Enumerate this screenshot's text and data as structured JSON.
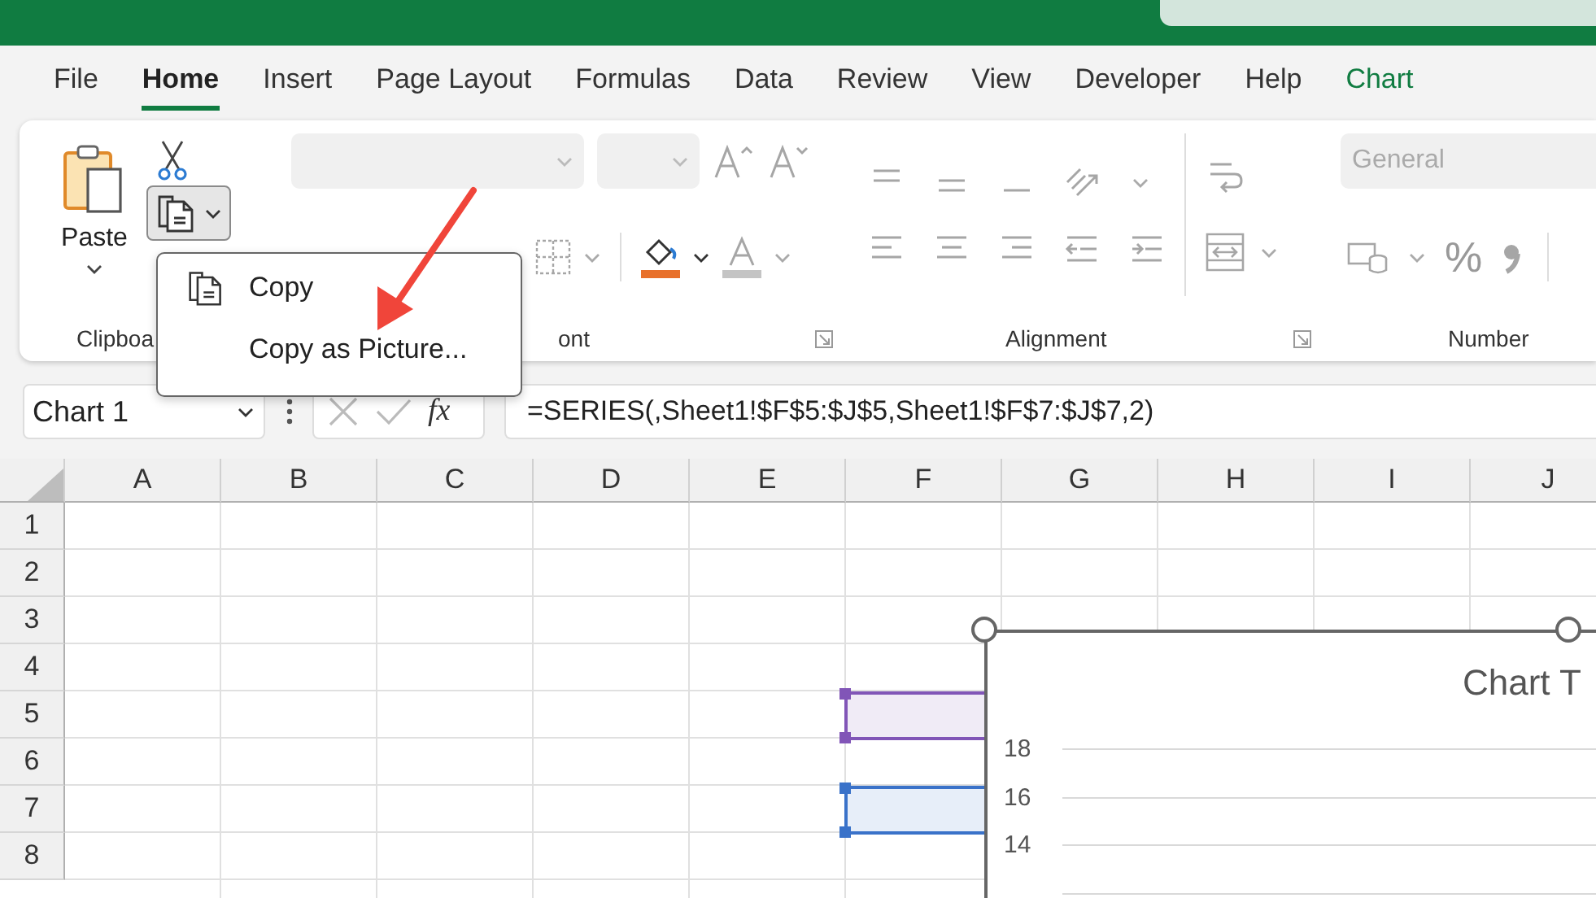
{
  "menu_tabs": [
    {
      "label": "File",
      "selected": false,
      "kind": "standard"
    },
    {
      "label": "Home",
      "selected": true,
      "kind": "standard"
    },
    {
      "label": "Insert",
      "selected": false,
      "kind": "standard"
    },
    {
      "label": "Page Layout",
      "selected": false,
      "kind": "standard"
    },
    {
      "label": "Formulas",
      "selected": false,
      "kind": "standard"
    },
    {
      "label": "Data",
      "selected": false,
      "kind": "standard"
    },
    {
      "label": "Review",
      "selected": false,
      "kind": "standard"
    },
    {
      "label": "View",
      "selected": false,
      "kind": "standard"
    },
    {
      "label": "Developer",
      "selected": false,
      "kind": "standard"
    },
    {
      "label": "Help",
      "selected": false,
      "kind": "standard"
    },
    {
      "label": "Chart",
      "selected": false,
      "kind": "contextual"
    }
  ],
  "ribbon": {
    "clipboard": {
      "paste_label": "Paste",
      "group_label": "Clipboa",
      "copy_pressed": true
    },
    "font": {
      "group_label": "ont",
      "disabled": true
    },
    "alignment": {
      "group_label": "Alignment",
      "disabled": true
    },
    "number": {
      "group_label": "Number",
      "format_placeholder": "General",
      "percent_symbol": "%",
      "disabled": true
    }
  },
  "copy_menu": {
    "items": [
      {
        "label": "Copy",
        "kind": "with_icon"
      },
      {
        "label": "Copy as Picture...",
        "kind": "plain"
      }
    ]
  },
  "formula_bar": {
    "name_box": "Chart 1",
    "function_symbol": "fx",
    "formula": "=SERIES(,Sheet1!$F$5:$J$5,Sheet1!$F$7:$J$7,2)"
  },
  "sheet": {
    "columns": [
      "A",
      "B",
      "C",
      "D",
      "E",
      "F",
      "G",
      "H",
      "I",
      "J"
    ],
    "rows": [
      "1",
      "2",
      "3",
      "4",
      "5",
      "6",
      "7",
      "8"
    ],
    "range_highlights": [
      {
        "color": "#8155b7"
      },
      {
        "color": "#3a72c9"
      }
    ]
  },
  "chart": {
    "title": "Chart T",
    "y_tick_labels": [
      "18",
      "16",
      "14"
    ]
  }
}
